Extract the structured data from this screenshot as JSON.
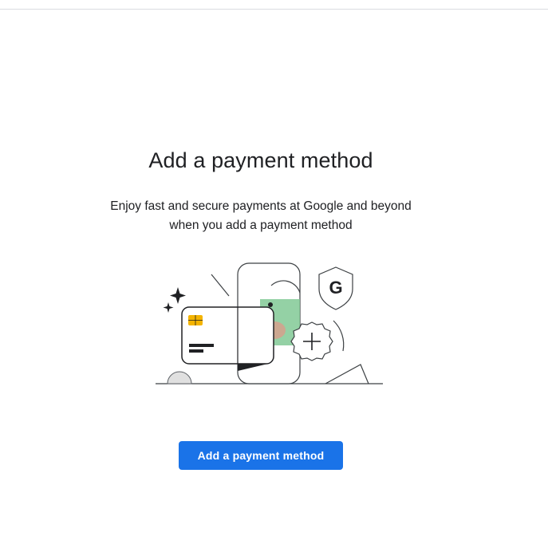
{
  "page": {
    "heading": "Add a payment method",
    "description_line1": "Enjoy fast and secure payments at Google and beyond",
    "description_line2": "when you add a payment method",
    "cta_label": "Add a payment method",
    "illustration_badge_letter": "G"
  },
  "colors": {
    "cta_background": "#1a73e8",
    "cta_text": "#ffffff",
    "heading_text": "#202124",
    "card_chip": "#f4b400",
    "phone_screen": "#81c995",
    "thumb_accent": "#f28b82",
    "ground_circle": "#e0e0e0"
  },
  "icons": [
    "sparkle-icon",
    "credit-card-icon",
    "phone-icon",
    "google-shield-icon",
    "add-badge-icon"
  ]
}
